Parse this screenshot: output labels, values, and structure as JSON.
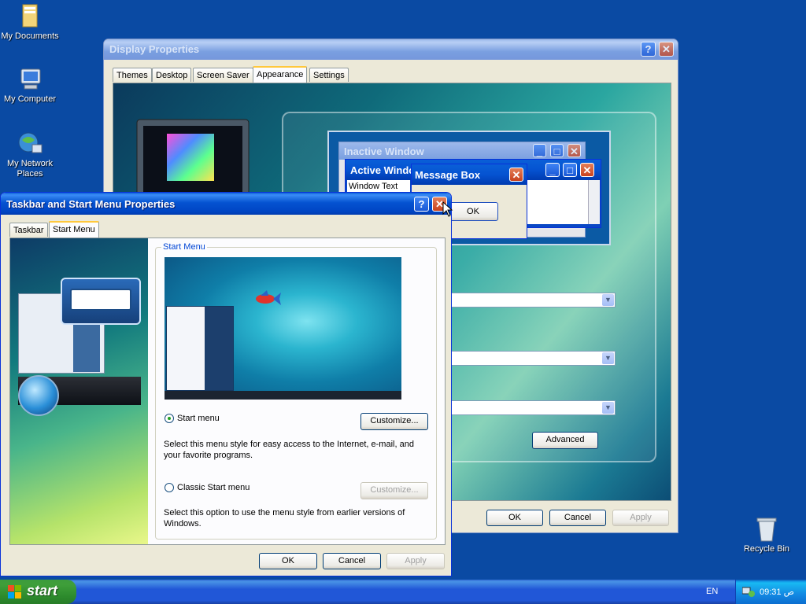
{
  "desktop": {
    "icons": [
      {
        "label": "My Documents"
      },
      {
        "label": "My Computer"
      },
      {
        "label": "My Network Places"
      },
      {
        "label": "Recycle Bin"
      }
    ]
  },
  "display_props": {
    "title": "Display Properties",
    "tabs": [
      "Themes",
      "Desktop",
      "Screen Saver",
      "Appearance",
      "Settings"
    ],
    "selected_tab": "Appearance",
    "preview": {
      "inactive_title": "Inactive Window",
      "active_title": "Active Window",
      "window_text": "Window Text",
      "message_box_title": "Message Box",
      "message_ok": "OK"
    },
    "advanced_label": "Advanced",
    "buttons": {
      "ok": "OK",
      "cancel": "Cancel",
      "apply": "Apply"
    }
  },
  "taskbar_props": {
    "title": "Taskbar and Start Menu Properties",
    "tabs": [
      "Taskbar",
      "Start Menu"
    ],
    "selected_tab": "Start Menu",
    "group_label": "Start Menu",
    "start_menu_option": "Start menu",
    "start_menu_desc": "Select this menu style for easy access to the Internet, e-mail, and your favorite programs.",
    "classic_option": "Classic Start menu",
    "classic_desc": "Select this option to use the menu style from earlier versions of Windows.",
    "customize_label": "Customize...",
    "customize_disabled_label": "Customize...",
    "selected_option": "Start menu",
    "buttons": {
      "ok": "OK",
      "cancel": "Cancel",
      "apply": "Apply"
    }
  },
  "taskbar": {
    "start_label": "start",
    "language": "EN",
    "clock": "09:31 ص"
  },
  "colors": {
    "desktop": "#0a4aa3",
    "title_active": "#0553d1",
    "start_green": "#3f9f3a"
  }
}
